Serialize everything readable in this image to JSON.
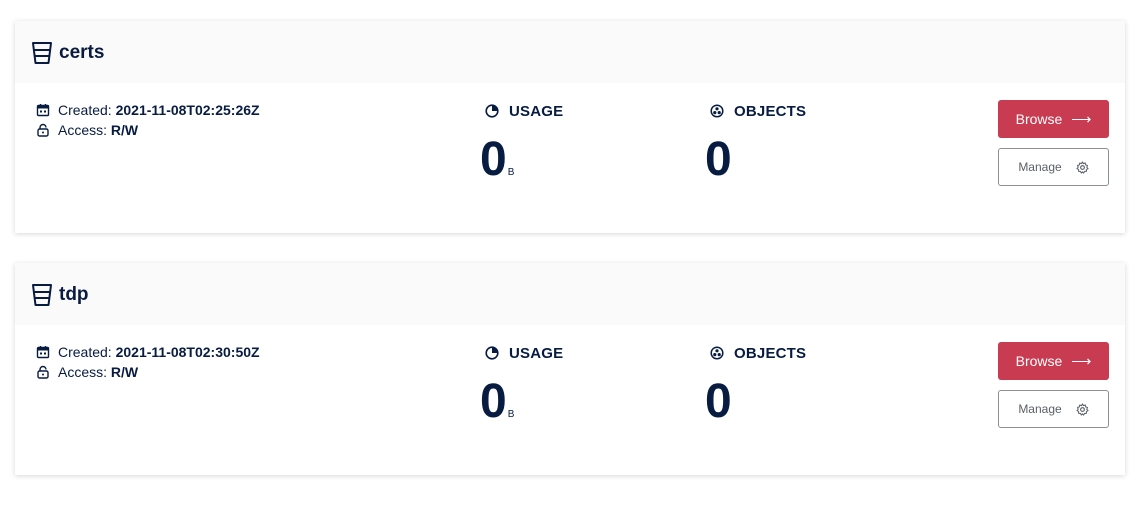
{
  "buckets": [
    {
      "name": "certs",
      "created_label": "Created:",
      "created_value": "2021-11-08T02:25:26Z",
      "access_label": "Access:",
      "access_value": "R/W",
      "usage_label": "USAGE",
      "usage_value": "0",
      "usage_unit": "B",
      "objects_label": "OBJECTS",
      "objects_value": "0",
      "browse_label": "Browse",
      "manage_label": "Manage"
    },
    {
      "name": "tdp",
      "created_label": "Created:",
      "created_value": "2021-11-08T02:30:50Z",
      "access_label": "Access:",
      "access_value": "R/W",
      "usage_label": "USAGE",
      "usage_value": "0",
      "usage_unit": "B",
      "objects_label": "OBJECTS",
      "objects_value": "0",
      "browse_label": "Browse",
      "manage_label": "Manage"
    }
  ],
  "icons": {
    "bucket": "bucket-icon",
    "calendar": "calendar-icon",
    "lock": "lock-icon",
    "usage": "pie-chart-icon",
    "objects": "objects-icon",
    "browse_arrow": "arrow-right-icon",
    "manage": "gear-icon"
  },
  "colors": {
    "text": "#081c42",
    "browse_button": "#c83b51",
    "header_bg": "#fbfafa",
    "manage_border": "#8a8f98"
  }
}
